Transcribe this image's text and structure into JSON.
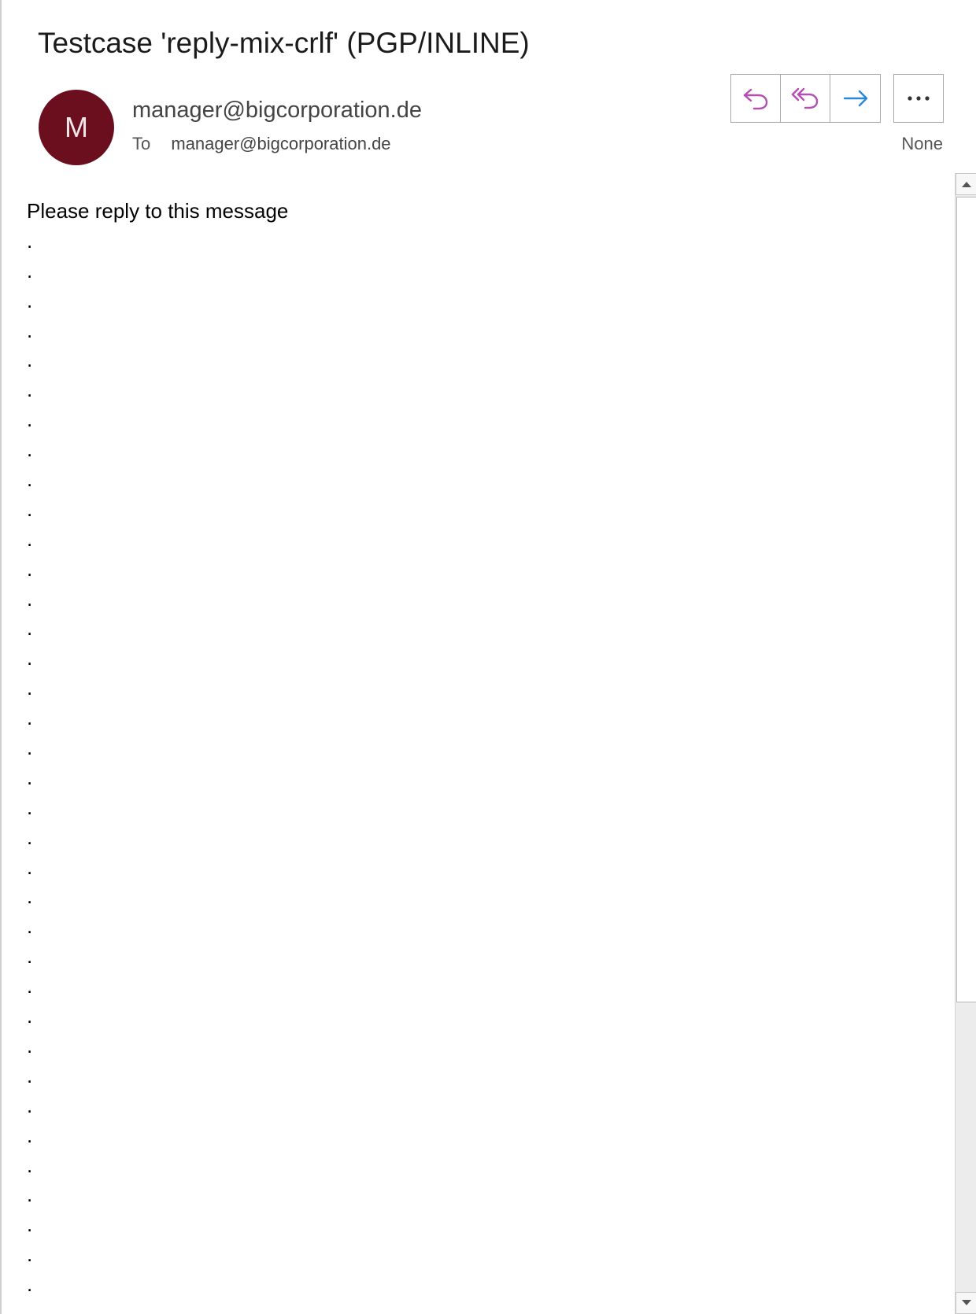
{
  "message": {
    "subject": "Testcase 'reply-mix-crlf' (PGP/INLINE)",
    "avatar_initial": "M",
    "avatar_color": "#6b0f1f",
    "sender": "manager@bigcorporation.de",
    "to_label": "To",
    "to_address": "manager@bigcorporation.de",
    "category": "None"
  },
  "actions": {
    "reply_icon": "reply-icon",
    "reply_all_icon": "reply-all-icon",
    "forward_icon": "forward-icon",
    "more_icon": "more-icon",
    "reply_color": "#b34fb3",
    "forward_color": "#2b88d8"
  },
  "body": {
    "first_line": "Please reply to this message",
    "dot_lines": [
      ".",
      ".",
      ".",
      ".",
      ".",
      ".",
      ".",
      ".",
      ".",
      ".",
      ".",
      ".",
      ".",
      ".",
      ".",
      ".",
      ".",
      ".",
      ".",
      ".",
      ".",
      ".",
      ".",
      ".",
      ".",
      ".",
      ".",
      ".",
      ".",
      ".",
      ".",
      ".",
      ".",
      ".",
      ".",
      "."
    ]
  }
}
